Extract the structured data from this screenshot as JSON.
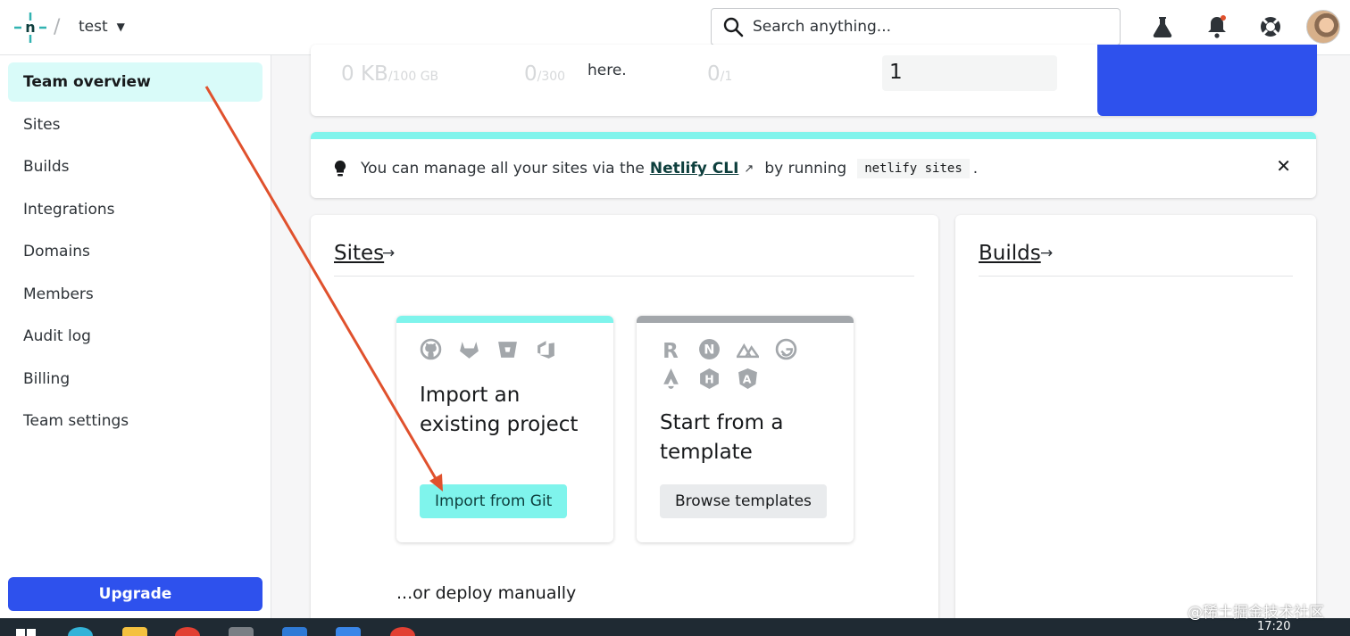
{
  "header": {
    "team_name": "test",
    "search_placeholder": "Search anything..."
  },
  "sidebar": {
    "items": [
      {
        "label": "Team overview",
        "active": true
      },
      {
        "label": "Sites"
      },
      {
        "label": "Builds"
      },
      {
        "label": "Integrations"
      },
      {
        "label": "Domains"
      },
      {
        "label": "Members"
      },
      {
        "label": "Audit log"
      },
      {
        "label": "Billing"
      },
      {
        "label": "Team settings"
      }
    ],
    "upgrade_label": "Upgrade"
  },
  "usage": {
    "bandwidth_value": "0 KB",
    "bandwidth_limit": "/100 GB",
    "build_value": "0",
    "build_limit": "/300",
    "here_text": "here.",
    "members_value": "0",
    "members_limit": "/1",
    "count_value": "1"
  },
  "cli_banner": {
    "text_before": "You can manage all your sites via the",
    "link_label": "Netlify CLI",
    "link_icon": "↗",
    "text_middle": "by running",
    "command": "netlify sites",
    "text_after": ".",
    "close_icon": "✕"
  },
  "sites_panel": {
    "title": "Sites",
    "arrow": "→",
    "import_card": {
      "heading": "Import an existing project",
      "button_label": "Import from Git",
      "icons": [
        "github-icon",
        "gitlab-icon",
        "bitbucket-icon",
        "azure-devops-icon"
      ]
    },
    "template_card": {
      "heading": "Start from a template",
      "button_label": "Browse templates",
      "icons": [
        "remix-icon",
        "nextjs-icon",
        "nuxt-icon",
        "gatsby-icon",
        "astro-icon",
        "hugo-icon",
        "angular-icon"
      ]
    },
    "deploy_manually": "...or deploy manually"
  },
  "builds_panel": {
    "title": "Builds",
    "arrow": "→"
  },
  "watermark": "@稀土掘金技术社区",
  "taskbar": {
    "time": "17:20"
  },
  "colors": {
    "accent_teal": "#7ff4ec",
    "brand_blue": "#2e51ed",
    "annotation_arrow": "#e0512d"
  }
}
